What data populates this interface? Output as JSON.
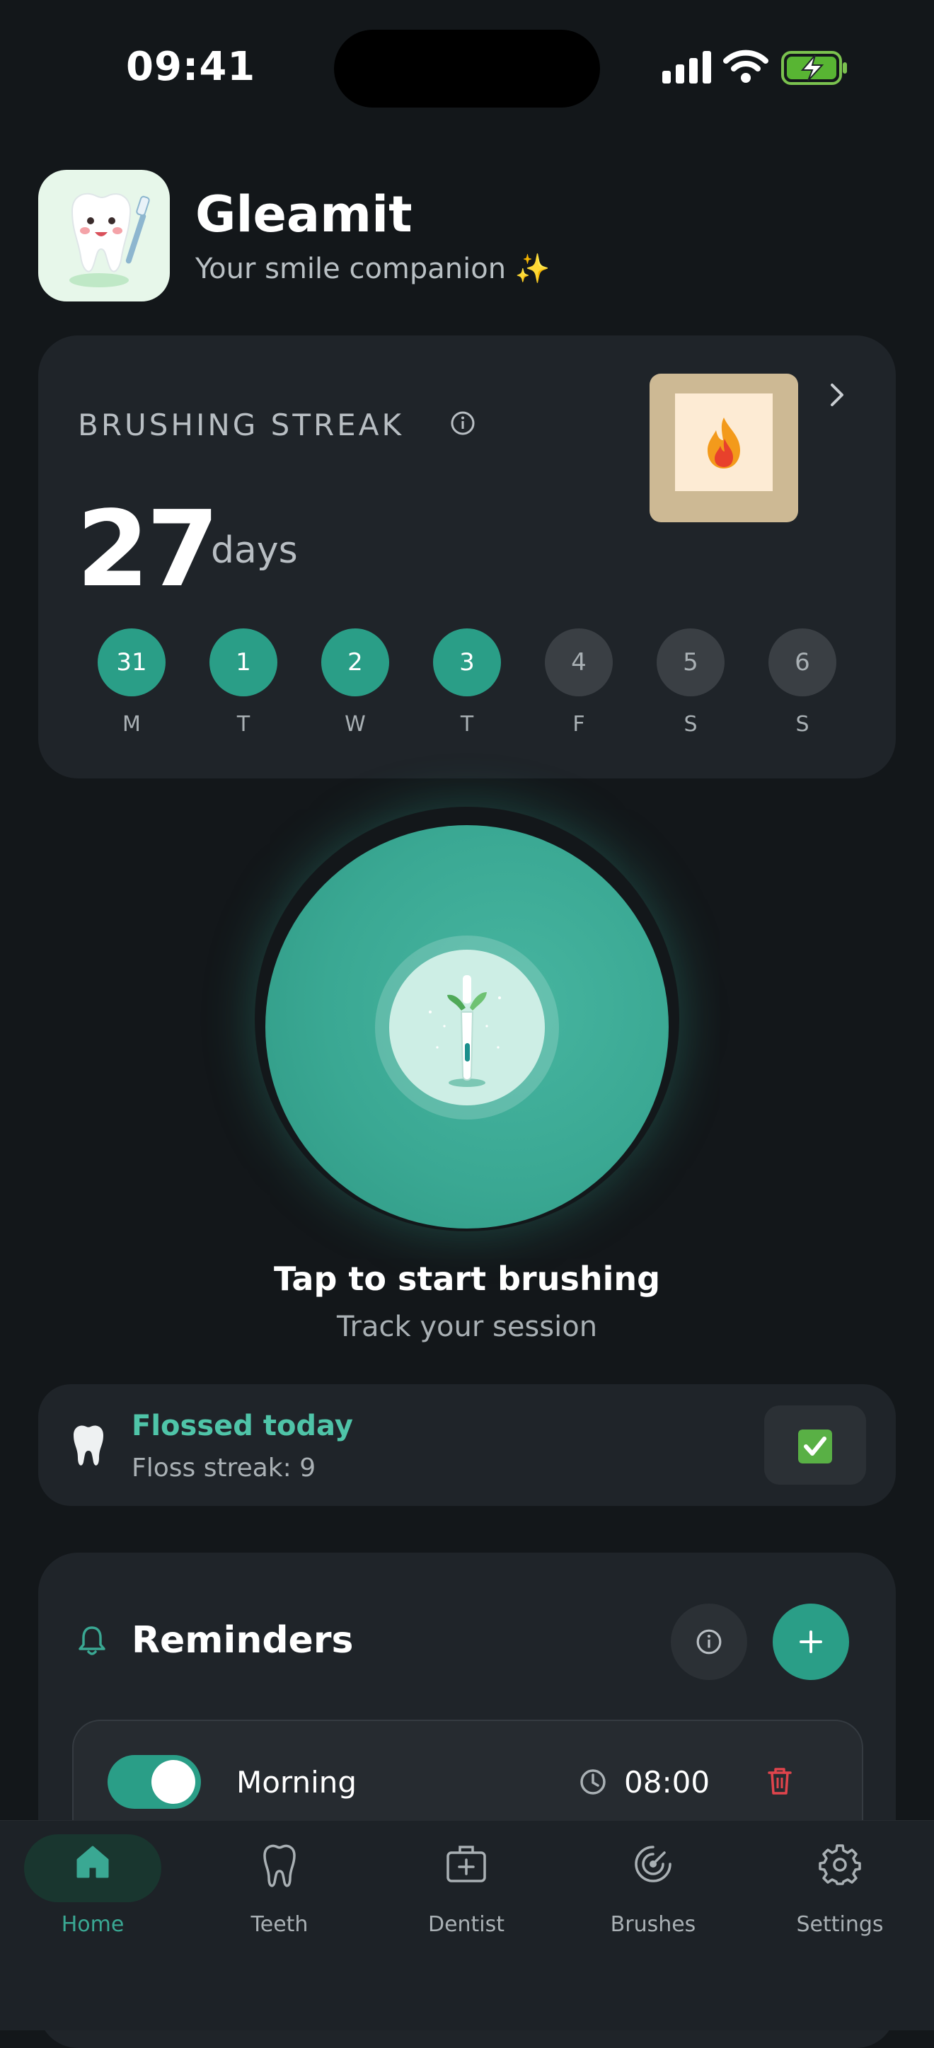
{
  "status": {
    "time": "09:41"
  },
  "header": {
    "app_name": "Gleamit",
    "subtitle": "Your smile companion ✨"
  },
  "streak": {
    "title": "BRUSHING STREAK",
    "count": "27",
    "unit": "days",
    "days": [
      {
        "num": "31",
        "label": "M",
        "done": true
      },
      {
        "num": "1",
        "label": "T",
        "done": true
      },
      {
        "num": "2",
        "label": "W",
        "done": true
      },
      {
        "num": "3",
        "label": "T",
        "done": true
      },
      {
        "num": "4",
        "label": "F",
        "done": false
      },
      {
        "num": "5",
        "label": "S",
        "done": false
      },
      {
        "num": "6",
        "label": "S",
        "done": false
      }
    ]
  },
  "brush": {
    "title": "Tap to start brushing",
    "subtitle": "Track your session"
  },
  "floss": {
    "title": "Flossed today",
    "streak": "Floss streak: 9",
    "checked": true
  },
  "reminders": {
    "title": "Reminders",
    "items": [
      {
        "label": "Morning",
        "time": "08:00",
        "enabled": true
      }
    ]
  },
  "tabs": [
    {
      "label": "Home",
      "icon": "home-icon",
      "active": true
    },
    {
      "label": "Teeth",
      "icon": "tooth-icon",
      "active": false
    },
    {
      "label": "Dentist",
      "icon": "medical-kit-icon",
      "active": false
    },
    {
      "label": "Brushes",
      "icon": "brush-head-icon",
      "active": false
    },
    {
      "label": "Settings",
      "icon": "gear-icon",
      "active": false
    }
  ],
  "colors": {
    "accent": "#2a9e87",
    "accent_text": "#4fc4a8",
    "background": "#13171a",
    "card": "#1f2429",
    "danger": "#e0444c"
  }
}
